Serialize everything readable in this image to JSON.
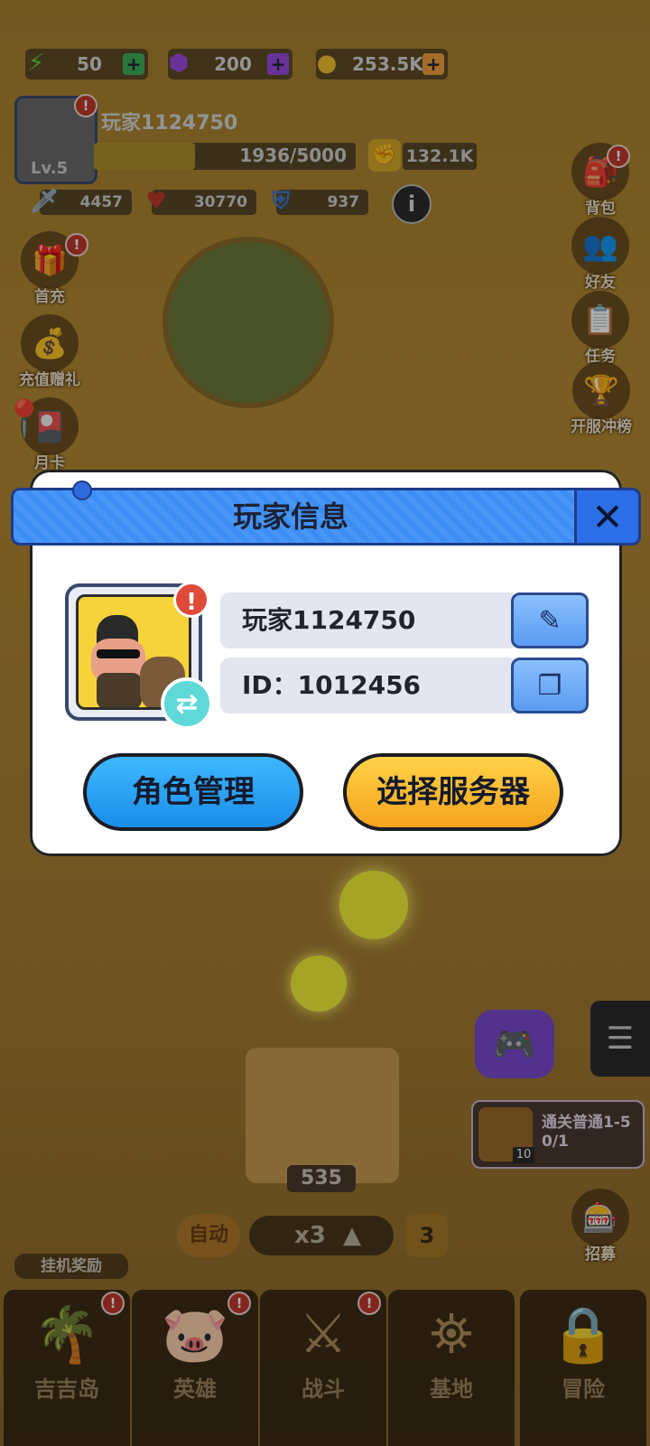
{
  "resources": {
    "energy": "50",
    "gems": "200",
    "coins": "253.5K"
  },
  "player": {
    "name": "玩家1124750",
    "level": "Lv.5",
    "exp": "1936/5000",
    "exp_progress": 0.387,
    "power": "132.1K"
  },
  "stats": {
    "attack": "4457",
    "hp": "30770",
    "defense": "937"
  },
  "left_menu": [
    "首充",
    "充值赠礼",
    "月卡"
  ],
  "right_menu": [
    "背包",
    "好友",
    "任务",
    "开服冲榜"
  ],
  "modal": {
    "title": "玩家信息",
    "name_value": "玩家1124750",
    "id_value": "ID：1012456",
    "role_button": "角色管理",
    "server_button": "选择服务器"
  },
  "game": {
    "chest_count": "535",
    "auto_label": "自动",
    "speed": "x3",
    "speed_level": "3",
    "quest_title": "通关普通1-5",
    "quest_progress": "0/1",
    "quest_badge": "10",
    "recruit_label": "招募",
    "idle_reward_label": "挂机奖励"
  },
  "bottom_nav": [
    "吉吉岛",
    "英雄",
    "战斗",
    "基地",
    "冒险"
  ],
  "colors": {
    "modal_banner": "#3c8ef5",
    "blue_button": "#1a8de8",
    "yellow_button": "#f5a31c"
  }
}
